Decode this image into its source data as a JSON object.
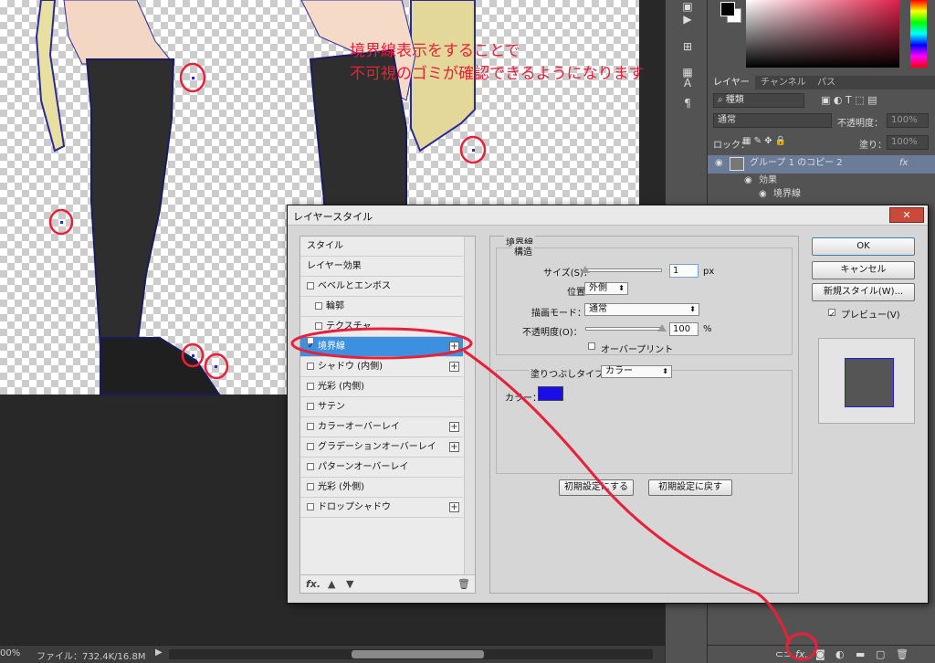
{
  "annotation": {
    "line1": "境界線表示をすることで",
    "line2": "不可視のゴミが確認できるようになります"
  },
  "statusbar": {
    "zoom": "00%",
    "file": "ファイル：732.4K/16.8M"
  },
  "layers_panel": {
    "tabs": [
      "レイヤー",
      "チャンネル",
      "パス"
    ],
    "filter_kind": "種類",
    "blend_mode": "通常",
    "opacity_label": "不透明度：",
    "opacity_value": "100%",
    "lock_label": "ロック：",
    "fill_label": "塗り：",
    "fill_value": "100%",
    "layer_name": "グループ 1 のコピー 2",
    "fx_badge": "fx",
    "effects_label": "効果",
    "effect_stroke": "境界線"
  },
  "dialog": {
    "title": "レイヤースタイル",
    "close": "✕",
    "styles": [
      {
        "label": "スタイル",
        "checkbox": false,
        "plus": false,
        "sub": false
      },
      {
        "label": "レイヤー効果",
        "checkbox": false,
        "plus": false,
        "sub": false
      },
      {
        "label": "ベベルとエンボス",
        "checkbox": true,
        "checked": false,
        "plus": false,
        "sub": false
      },
      {
        "label": "輪郭",
        "checkbox": true,
        "checked": false,
        "plus": false,
        "sub": true
      },
      {
        "label": "テクスチャ",
        "checkbox": true,
        "checked": false,
        "plus": false,
        "sub": true
      },
      {
        "label": "境界線",
        "checkbox": true,
        "checked": true,
        "plus": true,
        "sub": false,
        "selected": true
      },
      {
        "label": "シャドウ (内側)",
        "checkbox": true,
        "checked": false,
        "plus": true,
        "sub": false
      },
      {
        "label": "光彩 (内側)",
        "checkbox": true,
        "checked": false,
        "plus": false,
        "sub": false
      },
      {
        "label": "サテン",
        "checkbox": true,
        "checked": false,
        "plus": false,
        "sub": false
      },
      {
        "label": "カラーオーバーレイ",
        "checkbox": true,
        "checked": false,
        "plus": true,
        "sub": false
      },
      {
        "label": "グラデーションオーバーレイ",
        "checkbox": true,
        "checked": false,
        "plus": true,
        "sub": false
      },
      {
        "label": "パターンオーバーレイ",
        "checkbox": true,
        "checked": false,
        "plus": false,
        "sub": false
      },
      {
        "label": "光彩 (外側)",
        "checkbox": true,
        "checked": false,
        "plus": false,
        "sub": false
      },
      {
        "label": "ドロップシャドウ",
        "checkbox": true,
        "checked": false,
        "plus": true,
        "sub": false
      }
    ],
    "footer_fx": "fx.",
    "stroke": {
      "section_title": "境界線",
      "structure_title": "構造",
      "size_label": "サイズ(S)：",
      "size_value": "1",
      "size_unit": "px",
      "size_level": 0.0,
      "position_label": "位置：",
      "position_value": "外側",
      "blend_label": "描画モード：",
      "blend_value": "通常",
      "opacity_label": "不透明度(O)：",
      "opacity_value": "100",
      "opacity_unit": "%",
      "opacity_level": 1.0,
      "overprint_label": "オーバープリント",
      "fill_type_label": "塗りつぶしタイプ：",
      "fill_type_value": "カラー",
      "color_label": "カラー：",
      "color_value": "#1a0ee8",
      "default_set": "初期設定にする",
      "default_reset": "初期設定に戻す"
    },
    "buttons": {
      "ok": "OK",
      "cancel": "キャンセル",
      "new_style": "新規スタイル(W)...",
      "preview_label": "プレビュー(V)"
    }
  },
  "colors": {
    "annotation_red": "#e8203a",
    "selection_blue": "#3d8fe0",
    "stroke_color": "#1a0ee8"
  }
}
